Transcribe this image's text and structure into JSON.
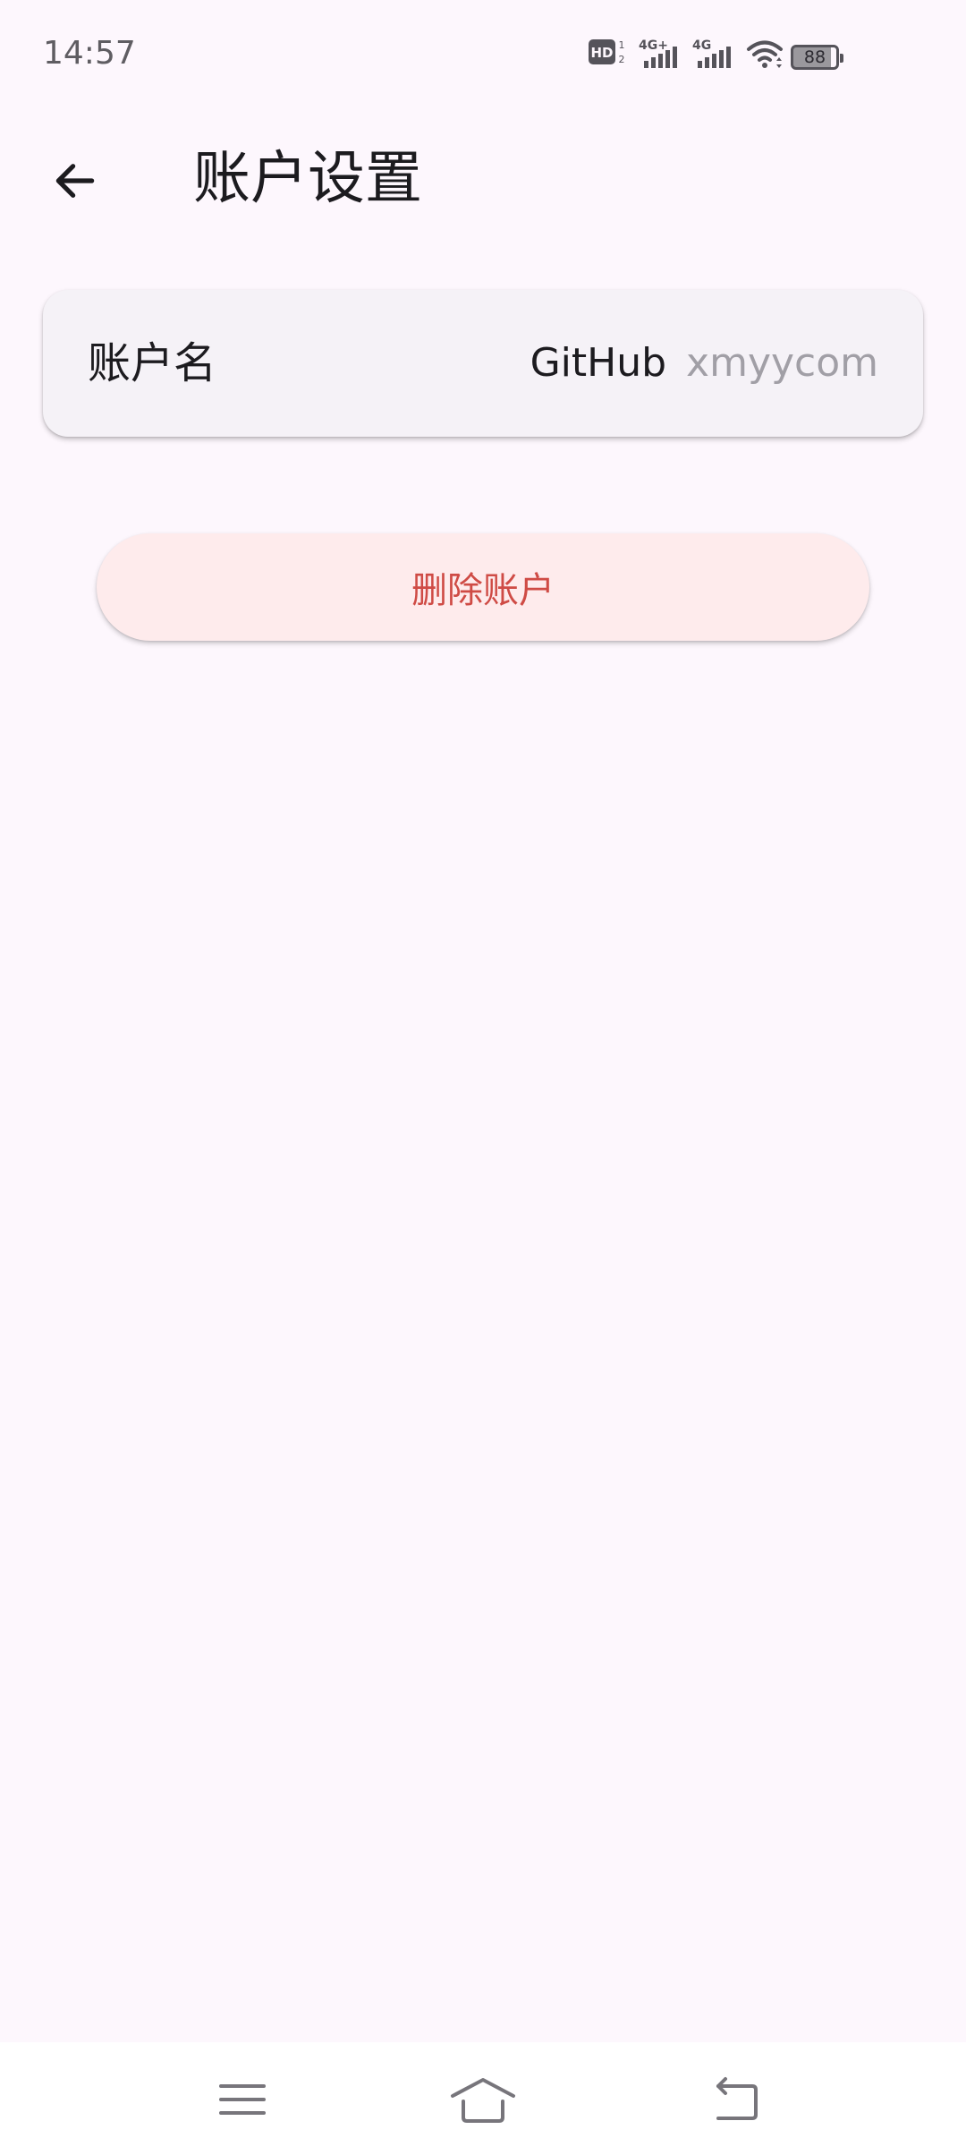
{
  "status_bar": {
    "time": "14:57",
    "network_badge": "HD",
    "signal_1_label": "4G+",
    "signal_2_label": "4G",
    "battery_level": "88"
  },
  "app_bar": {
    "title": "账户设置",
    "back_icon": "arrow-left-icon"
  },
  "account_card": {
    "label": "账户名",
    "provider": "GitHub",
    "username": "xmyycom"
  },
  "actions": {
    "delete_label": "删除账户"
  },
  "nav_bar": {
    "icons": [
      "menu-icon",
      "home-icon",
      "back-icon"
    ]
  },
  "colors": {
    "background": "#fdf7fd",
    "card": "#f5f2f7",
    "danger_bg": "#feebec",
    "danger_text": "#cf4b45"
  }
}
